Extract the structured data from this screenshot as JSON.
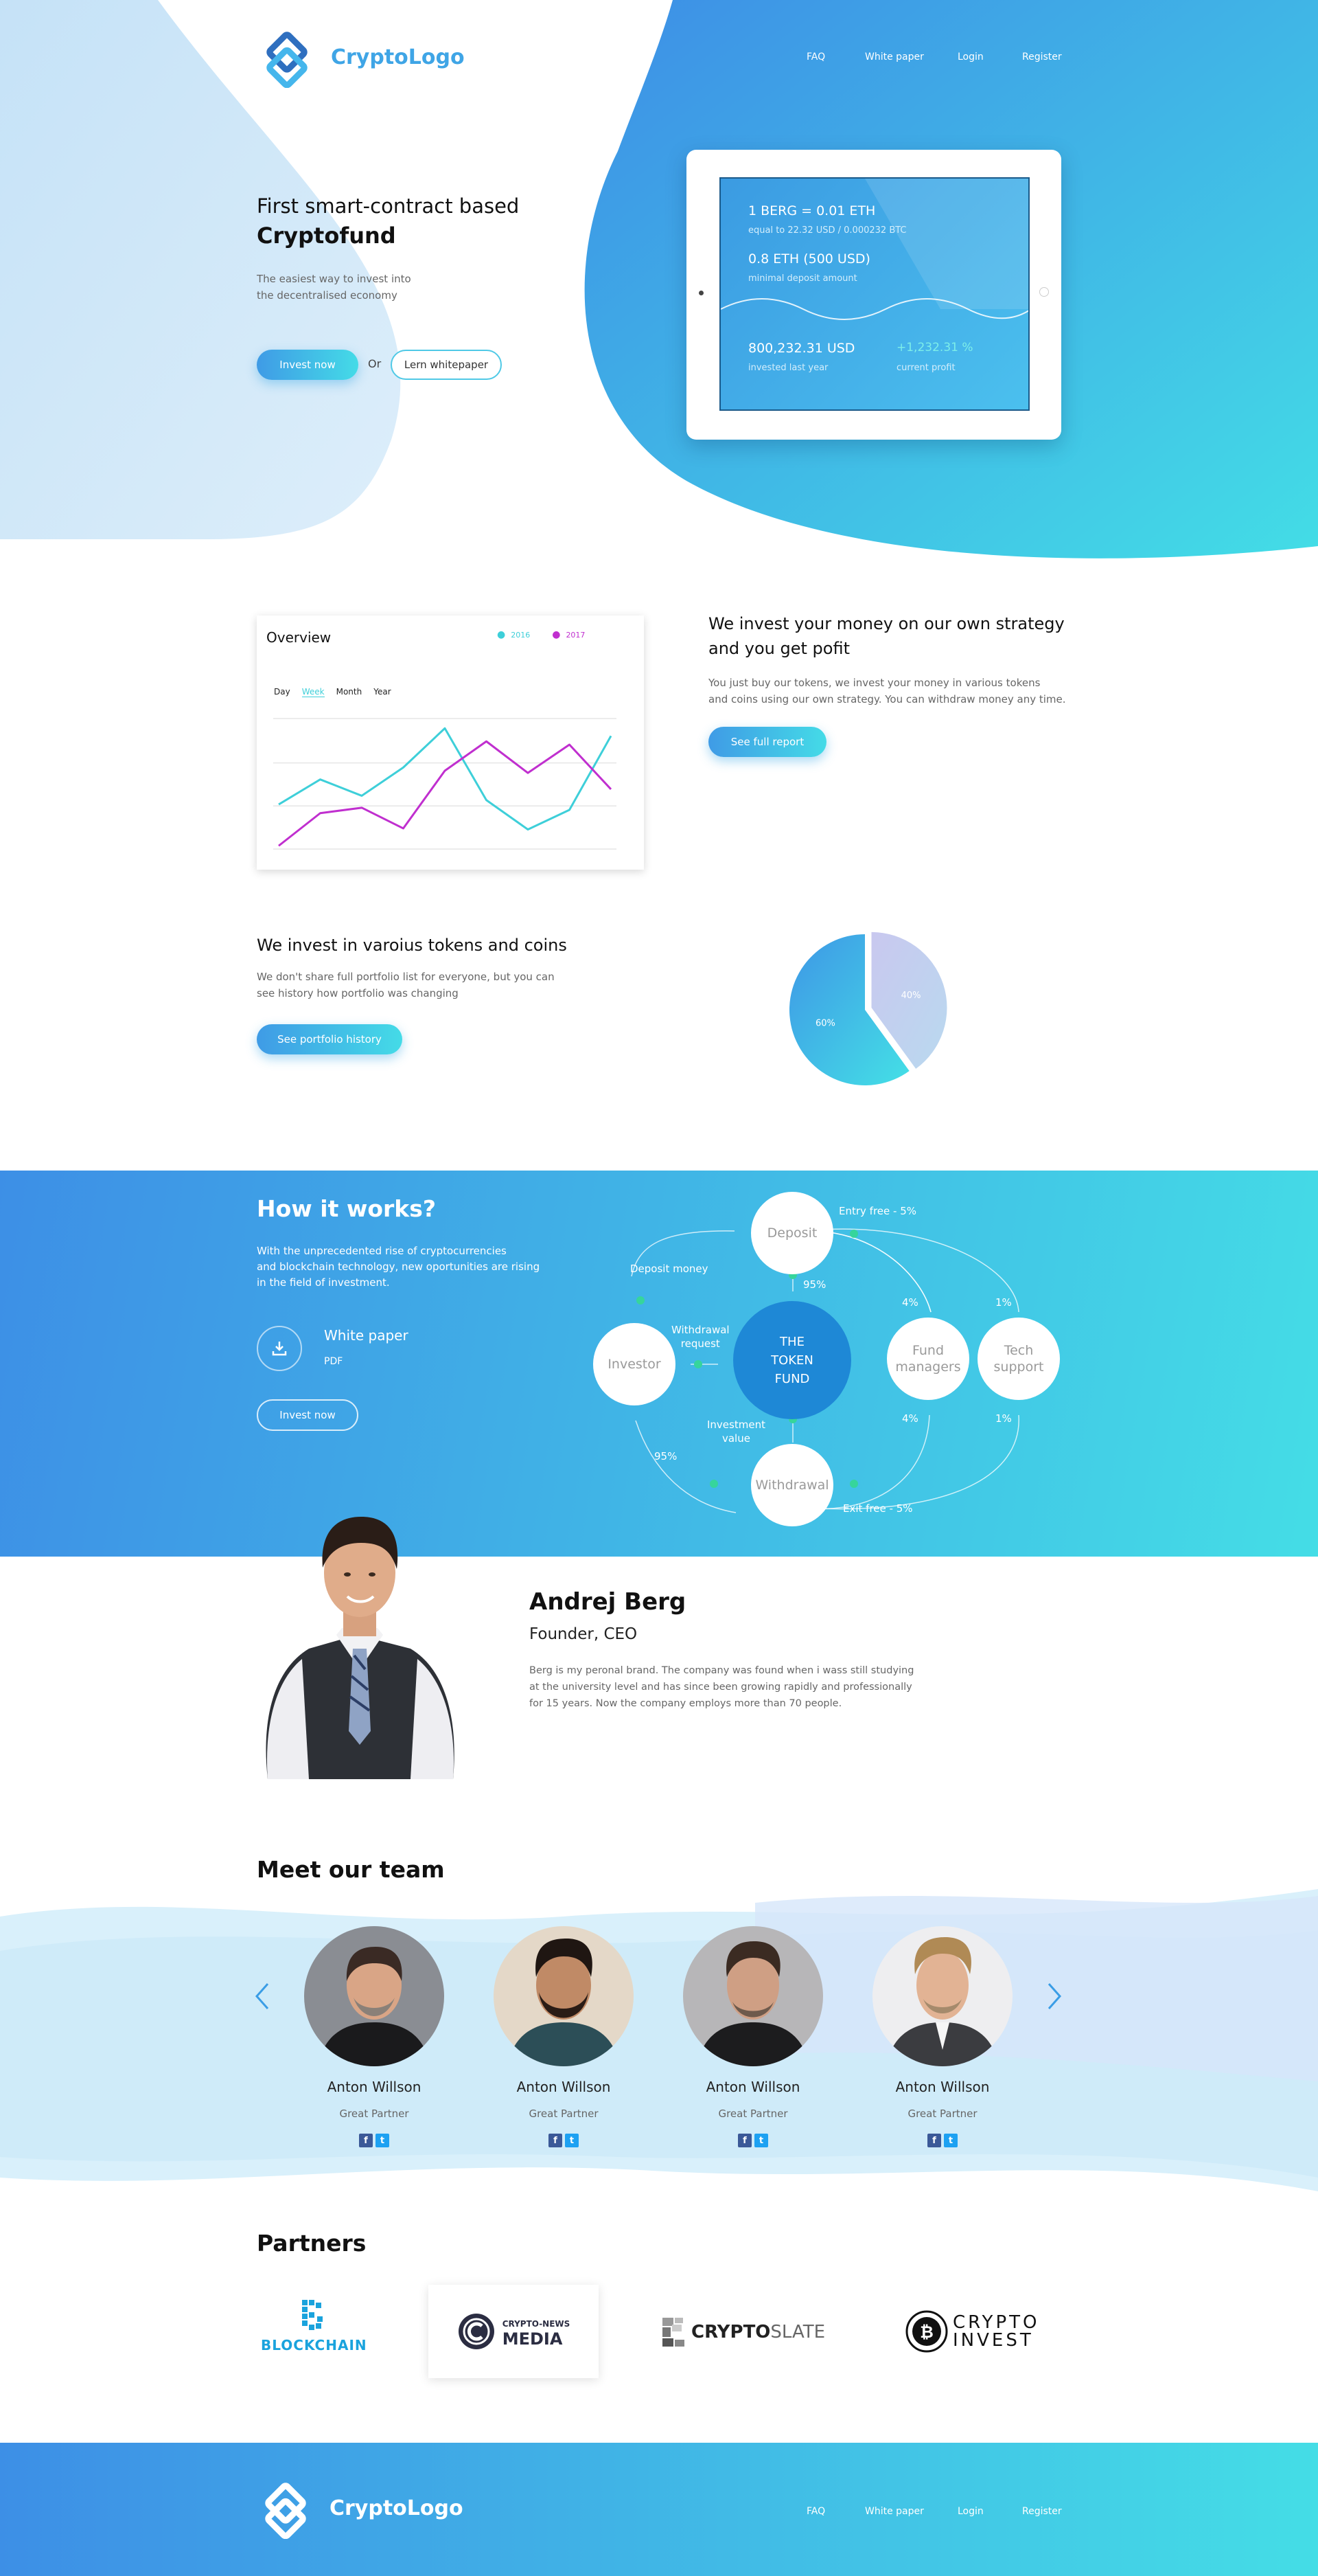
{
  "brand": {
    "name": "CryptoLogo"
  },
  "nav": {
    "faq": "FAQ",
    "whitepaper": "White paper",
    "login": "Login",
    "register": "Register"
  },
  "hero": {
    "title_line1": "First smart-contract based",
    "title_line2": "Cryptofund",
    "subtitle_line1": "The easiest way to invest into",
    "subtitle_line2": "the decentralised economy",
    "invest_button": "Invest now",
    "or_text": "Or",
    "whitepaper_button": "Lern whitepaper"
  },
  "tablet": {
    "rate": "1 BERG = 0.01 ETH",
    "rate_sub": "equal to 22.32 USD / 0.000232 BTC",
    "min_deposit": "0.8 ETH (500 USD)",
    "min_deposit_label": "minimal deposit amount",
    "invested": "800,232.31 USD",
    "invested_label": "invested last year",
    "profit": "+1,232.31 %",
    "profit_label": "current profit"
  },
  "overview": {
    "title": "Overview",
    "legend_2016": "2016",
    "legend_2017": "2017",
    "tabs": [
      "Day",
      "Week",
      "Month",
      "Year"
    ],
    "active_tab": "Week"
  },
  "chart_data": {
    "type": "line",
    "x": [
      1,
      2,
      3,
      4,
      5,
      6,
      7,
      8,
      9
    ],
    "series": [
      {
        "name": "2016",
        "values": [
          41,
          64,
          49,
          75,
          111,
          45,
          18,
          36,
          104
        ]
      },
      {
        "name": "2017",
        "values": [
          3,
          33,
          38,
          19,
          72,
          99,
          70,
          96,
          55
        ]
      }
    ],
    "ylim": [
      0,
      120
    ],
    "grid": true,
    "legend": "top-right",
    "colors": {
      "2016": "#3ecfd9",
      "2017": "#c02fcf"
    }
  },
  "strategy": {
    "title_line1": "We invest your money on our own strategy",
    "title_line2": "and you get pofit",
    "text_line1": "You just buy our tokens, we invest your money in various tokens",
    "text_line2": "and coins using our own strategy. You can withdraw money any time.",
    "button": "See full report"
  },
  "tokens": {
    "title": "We invest in varoius tokens and coins",
    "text_line1": "We don't share  full portfolio list for everyone, but you can",
    "text_line2": "see history how portfolio was changing",
    "button": "See portfolio history",
    "pie_label_big": "60%",
    "pie_label_small": "40%"
  },
  "pie_data": {
    "type": "pie",
    "values": [
      60,
      40
    ],
    "labels": [
      "60%",
      "40%"
    ],
    "colors": [
      "#3fa0e8",
      "#c5cdea"
    ]
  },
  "how": {
    "title": "How it works?",
    "text_line1": "With the unprecedented rise of cryptocurrencies",
    "text_line2": "and blockchain technology, new oportunities  are rising",
    "text_line3": "in the field of investment.",
    "whitepaper_title": "White paper",
    "whitepaper_format": "PDF",
    "invest_button": "Invest now",
    "nodes": {
      "deposit": "Deposit",
      "investor": "Investor",
      "fund_line1": "THE",
      "fund_line2": "TOKEN",
      "fund_line3": "FUND",
      "fund_managers_line1": "Fund",
      "fund_managers_line2": "managers",
      "tech_line1": "Tech",
      "tech_line2": "support",
      "withdrawal": "Withdrawal"
    },
    "labels": {
      "entry_free": "Entry free - 5%",
      "exit_free": "Exit free - 5%",
      "deposit_money": "Deposit money",
      "withdrawal_request_line1": "Withdrawal",
      "withdrawal_request_line2": "request",
      "investment_value_line1": "Investment",
      "investment_value_line2": "value",
      "pct_95_top": "95%",
      "pct_95_bottom": "95%",
      "pct_4_top": "4%",
      "pct_1_top": "1%",
      "pct_4_bottom": "4%",
      "pct_1_bottom": "1%"
    }
  },
  "founder": {
    "name": "Andrej Berg",
    "role": "Founder, CEO",
    "bio_line1": "Berg is my peronal brand. The company was found when i wass still studying",
    "bio_line2": "at the university level and has since been growing rapidly and professionally",
    "bio_line3": "for 15 years. Now the company employs more than 70 people."
  },
  "team": {
    "title": "Meet our team",
    "members": [
      {
        "name": "Anton Willson",
        "role": "Great Partner"
      },
      {
        "name": "Anton Willson",
        "role": "Great Partner"
      },
      {
        "name": "Anton Willson",
        "role": "Great Partner"
      },
      {
        "name": "Anton Willson",
        "role": "Great Partner"
      }
    ]
  },
  "partners": {
    "title": "Partners",
    "blockchain": "BLOCKCHAIN",
    "cryptonews_small": "CRYPTO-NEWS",
    "cryptonews_big": "MEDIA",
    "cryptoslate_a": "CRYPTO",
    "cryptoslate_b": "SLATE",
    "cryptoinvest_a": "CRYPTO",
    "cryptoinvest_b": "INVEST"
  },
  "footer": {
    "brand": "CryptoLogo",
    "faq": "FAQ",
    "whitepaper": "White paper",
    "login": "Login",
    "register": "Register"
  }
}
